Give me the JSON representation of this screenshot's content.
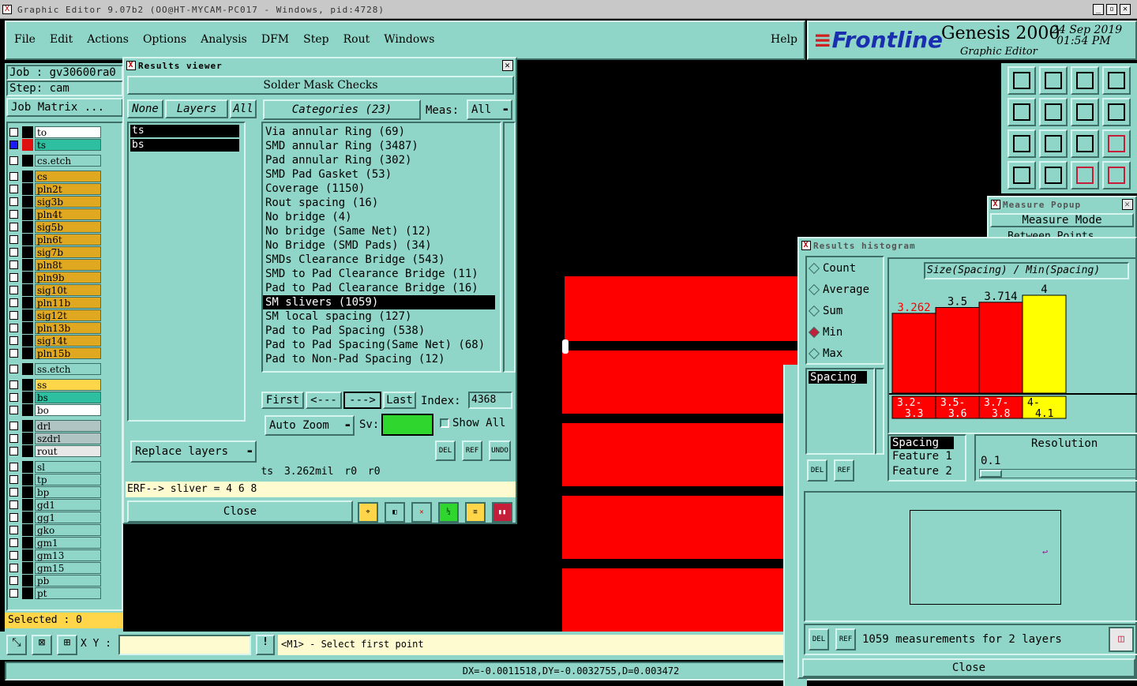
{
  "window": {
    "title": "Graphic Editor 9.07b2 (OO@HT-MYCAM-PC017 - Windows, pid:4728)"
  },
  "menu": {
    "items": [
      "File",
      "Edit",
      "Actions",
      "Options",
      "Analysis",
      "DFM",
      "Step",
      "Rout",
      "Windows"
    ],
    "help": "Help"
  },
  "brand": {
    "logo": "Frontline",
    "product": "Genesis 2000",
    "subtitle": "Graphic Editor",
    "date": "24 Sep 2019",
    "time": "01:54 PM"
  },
  "job": {
    "job_label": "Job : gv30600ra0",
    "step_label": "Step: cam",
    "matrix_button": "Job Matrix ..."
  },
  "layers": [
    "to",
    "ts",
    "cs.etch",
    "cs",
    "pln2t",
    "sig3b",
    "pln4t",
    "sig5b",
    "pln6t",
    "sig7b",
    "pln8t",
    "pln9b",
    "sig10t",
    "pln11b",
    "sig12t",
    "pln13b",
    "sig14t",
    "pln15b",
    "ss.etch",
    "ss",
    "bs",
    "bo",
    "drl",
    "szdrl",
    "rout",
    "sl",
    "tp",
    "bp",
    "gd1",
    "gg1",
    "gko",
    "gm1",
    "gm13",
    "gm15",
    "pb",
    "pt"
  ],
  "selected": "Selected : 0",
  "bottom": {
    "xy_label": "X Y :",
    "xy_value": "",
    "prompt": "<M1> - Select first point",
    "status": "DX=-0.0011518,DY=-0.0032755,D=0.003472"
  },
  "results_viewer": {
    "title": "Results viewer",
    "header": "Solder Mask Checks",
    "none_btn": "None",
    "layers_btn": "Layers",
    "all_btn": "All",
    "layer_list": [
      "ts",
      "bs"
    ],
    "categories_btn": "Categories (23)",
    "meas_label": "Meas:",
    "meas_value": "All",
    "categories": [
      "Via annular Ring (69)",
      "SMD annular Ring (3487)",
      "Pad annular Ring (302)",
      "SMD Pad Gasket (53)",
      "Coverage (1150)",
      "Rout spacing (16)",
      "No bridge (4)",
      "No bridge (Same Net) (12)",
      "No Bridge (SMD Pads) (34)",
      "SMDs Clearance Bridge (543)",
      "SMD to Pad Clearance Bridge (11)",
      "Pad to Pad Clearance Bridge (16)",
      "SM slivers (1059)",
      "SM local spacing (127)",
      "Pad to Pad Spacing (538)",
      "Pad to Pad Spacing(Same Net) (68)",
      "Pad to Non-Pad Spacing (12)"
    ],
    "first": "First",
    "prev": "<---",
    "next": "--->",
    "last": "Last",
    "index_label": "Index:",
    "index_value": "4368",
    "auto_zoom": "Auto Zoom",
    "sv_label": "Sv:",
    "show_all": "Show All",
    "replace_layers": "Replace layers",
    "del": "DEL",
    "ref": "REF",
    "undo": "UNDO",
    "info": "ts 3.262mil r0 r0",
    "erf": "ERF--> sliver = 4 6 8",
    "close": "Close"
  },
  "measure_popup": {
    "title": "Measure Popup",
    "mode": "Measure Mode",
    "option": "Between Points"
  },
  "histogram": {
    "title": "Results histogram",
    "radios": [
      "Count",
      "Average",
      "Sum",
      "Min",
      "Max"
    ],
    "selected_radio": "Min",
    "list": [
      "Spacing"
    ],
    "chart_title": "Size(Spacing) / Min(Spacing)",
    "fields": [
      "Spacing",
      "Feature 1",
      "Feature 2"
    ],
    "resolution_label": "Resolution",
    "resolution_value": "0.1",
    "summary": "1059 measurements for 2 layers",
    "close": "Close",
    "del": "DEL",
    "ref": "REF"
  },
  "chart_data": {
    "type": "bar",
    "categories": [
      "3.2-3.3",
      "3.5-3.6",
      "3.7-3.8",
      "4-4.1"
    ],
    "values": [
      3.262,
      3.5,
      3.714,
      4
    ],
    "labels": [
      "3.262",
      "3.5",
      "3.714",
      "4"
    ],
    "colors": [
      "#ff0000",
      "#ff0000",
      "#ff0000",
      "#ffff00"
    ],
    "highlight_label_color": "#ff0000"
  }
}
